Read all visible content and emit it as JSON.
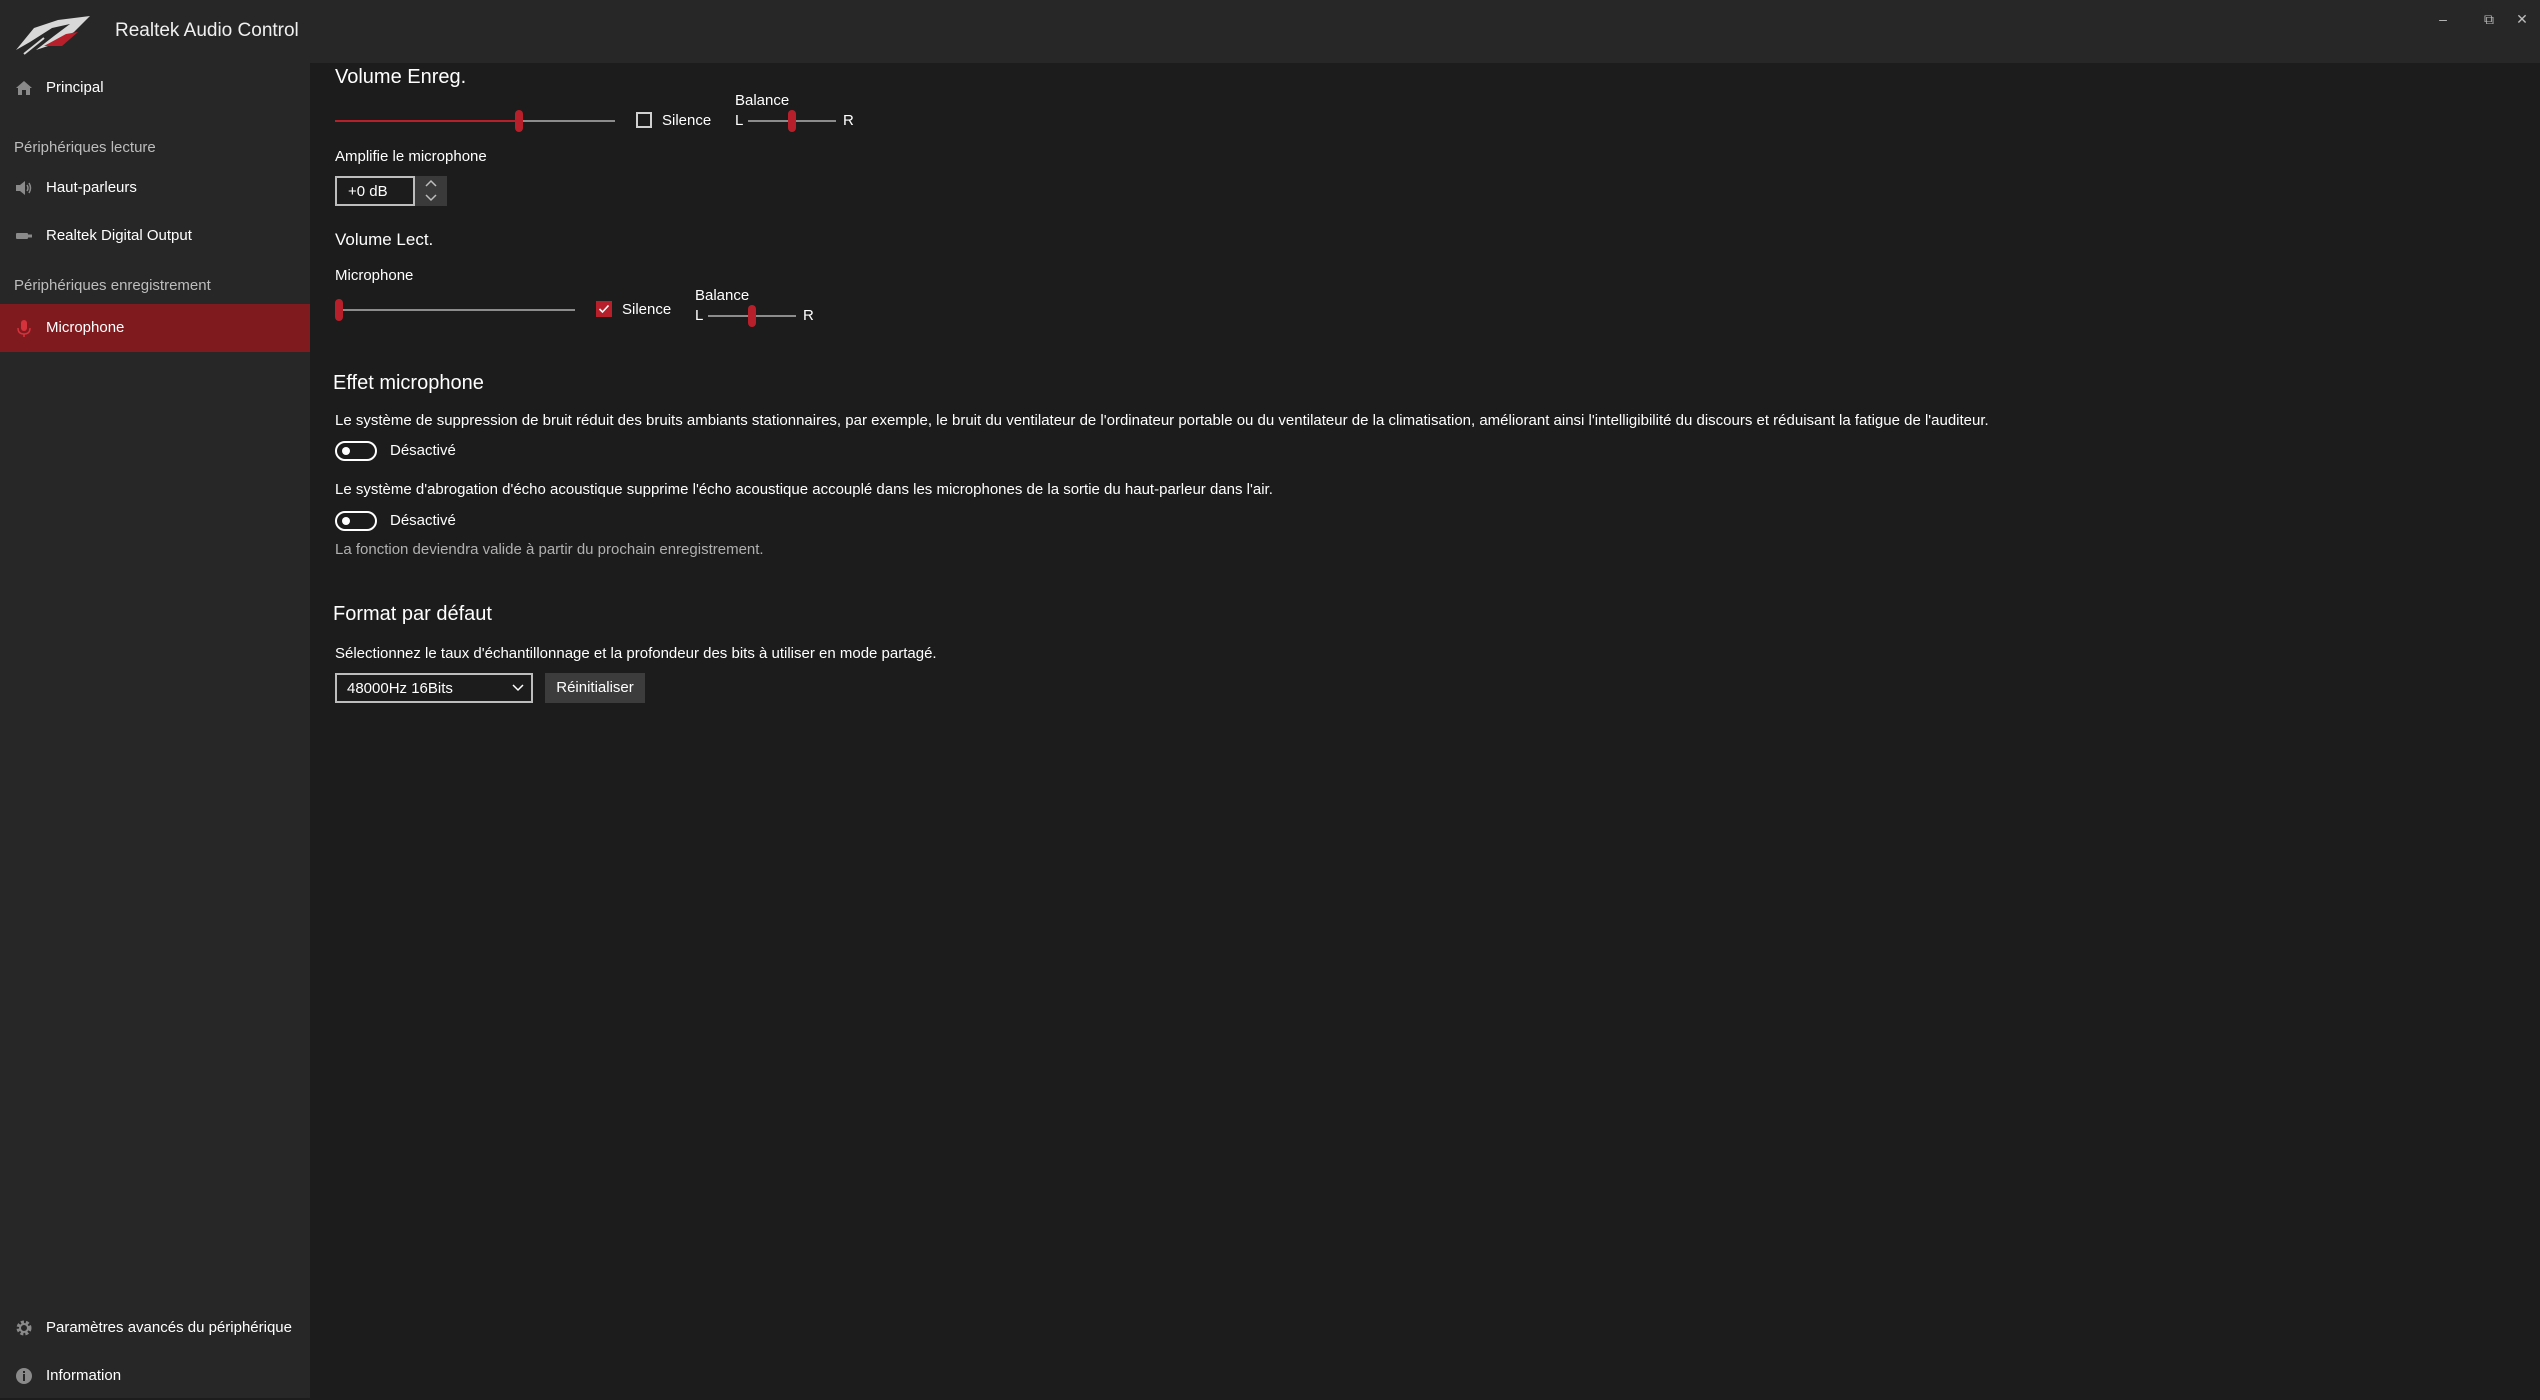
{
  "app": {
    "title": "Realtek Audio Control"
  },
  "window": {
    "minimize": "–",
    "restore": "⧉",
    "close": "✕"
  },
  "sidebar": {
    "principal": "Principal",
    "playback_header": "Périphériques lecture",
    "playback_items": [
      "Haut-parleurs",
      "Realtek Digital Output"
    ],
    "recording_header": "Périphériques enregistrement",
    "recording_items": [
      "Microphone"
    ],
    "bottom_items": [
      "Paramètres avancés du périphérique",
      "Information"
    ]
  },
  "record_volume": {
    "title": "Volume Enreg.",
    "level": 0.66,
    "mute_label": "Silence",
    "muted": false,
    "balance_label": "Balance",
    "balance_left": "L",
    "balance_right": "R",
    "balance": 0.5
  },
  "mic_boost": {
    "label": "Amplifie le microphone",
    "value": "+0 dB"
  },
  "playback_volume": {
    "title": "Volume Lect.",
    "channel_label": "Microphone",
    "level": 0.0,
    "mute_label": "Silence",
    "muted": true,
    "balance_label": "Balance",
    "balance_left": "L",
    "balance_right": "R",
    "balance": 0.5
  },
  "mic_effect": {
    "title": "Effet microphone",
    "noise_suppression_desc": "Le système de suppression de bruit réduit des bruits ambiants stationnaires, par exemple, le bruit du ventilateur de l'ordinateur portable ou du ventilateur de la climatisation, améliorant ainsi l'intelligibilité du discours et réduisant la fatigue de l'auditeur.",
    "noise_suppression_state": "Désactivé",
    "echo_cancel_desc": "Le système d'abrogation d'écho acoustique supprime l'écho acoustique accouplé dans les microphones de la sortie du haut-parleur dans l'air.",
    "echo_cancel_state": "Désactivé",
    "note": "La fonction deviendra valide à partir du prochain enregistrement."
  },
  "default_format": {
    "title": "Format par défaut",
    "desc": "Sélectionnez le taux d'échantillonnage et la profondeur des bits à utiliser en mode partagé.",
    "selected": "48000Hz 16Bits",
    "reset_label": "Réinitialiser"
  },
  "colors": {
    "accent": "#b7202a",
    "active_nav": "#7f1a1f",
    "sidebar_bg": "#272727",
    "content_bg": "#1c1c1c"
  },
  "icons": [
    "rog-logo-icon",
    "home-icon",
    "speaker-icon",
    "digital-output-icon",
    "microphone-icon",
    "gear-icon",
    "info-icon",
    "chevron-down-icon",
    "chevron-up-icon",
    "checkmark-icon"
  ]
}
